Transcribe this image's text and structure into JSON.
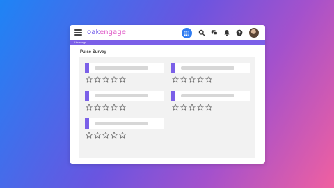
{
  "app": {
    "logo_main": "oak",
    "logo_accent": "engage"
  },
  "header": {
    "icons": [
      "menu-icon",
      "apps-grid-icon",
      "search-icon",
      "chat-icon",
      "bell-icon",
      "help-icon",
      "avatar"
    ]
  },
  "breadcrumb": {
    "text": "Homepage"
  },
  "page": {
    "title": "Pulse Survey"
  },
  "survey": {
    "questions": [
      {
        "rating": 0,
        "max": 5
      },
      {
        "rating": 0,
        "max": 5
      },
      {
        "rating": 0,
        "max": 5
      },
      {
        "rating": 0,
        "max": 5
      },
      {
        "rating": 0,
        "max": 5
      }
    ]
  },
  "colors": {
    "accent": "#7b60e8",
    "apps_button": "#2f7cf2",
    "panel": "#f2f2f2",
    "placeholder": "#d7d7d7"
  }
}
